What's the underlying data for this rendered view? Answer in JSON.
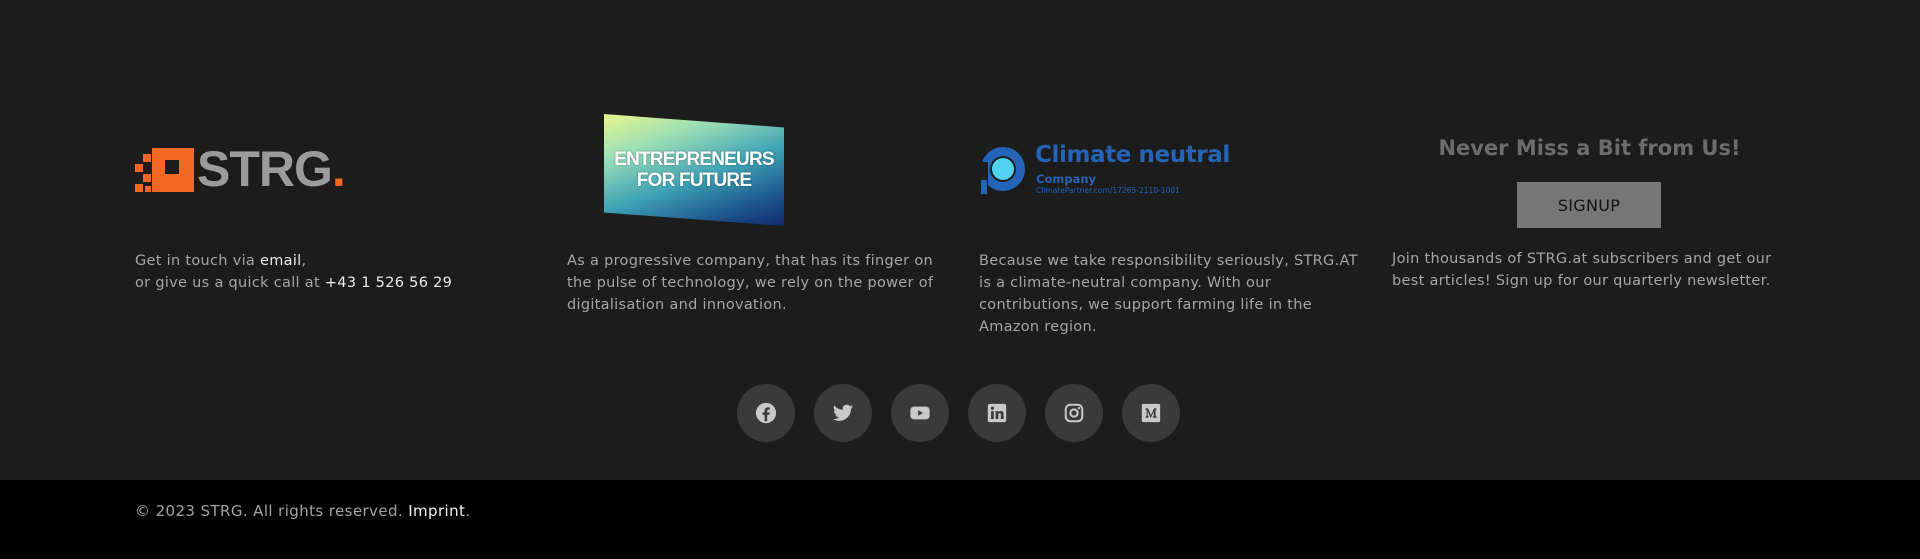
{
  "brand": {
    "logo_text": "STRG",
    "logo_dot": ".",
    "accent": "#f26722"
  },
  "contact": {
    "line1_prefix": "Get in touch via ",
    "email_label": "email",
    "line1_suffix": ",",
    "line2_prefix": "or give us a quick call at ",
    "phone": "+43 1 526 56 29"
  },
  "e4f": {
    "line1": "ENTREPRENEURS",
    "line2": "FOR FUTURE",
    "text": "As a progressive company, that has its finger on the pulse of technology, we rely on the power of digitalisation and innovation."
  },
  "climate": {
    "title": "Climate neutral",
    "subtitle": "Company",
    "url": "ClimatePartner.com/17265-2110-1001",
    "text": "Because we take responsibility seriously, STRG.AT is a climate-neutral company. With our contributions, we support farming life in the Amazon region.",
    "color": "#2464b7"
  },
  "newsletter": {
    "title": "Never Miss a Bit from Us!",
    "button": "SIGNUP",
    "text": "Join thousands of STRG.at subscribers and get our best articles! Sign up for our quarterly newsletter."
  },
  "social": [
    {
      "name": "facebook-icon"
    },
    {
      "name": "twitter-icon"
    },
    {
      "name": "youtube-icon"
    },
    {
      "name": "linkedin-icon"
    },
    {
      "name": "instagram-icon"
    },
    {
      "name": "medium-icon"
    }
  ],
  "bottom": {
    "copyright": "© 2023 STRG. All rights reserved. ",
    "imprint": "Imprint",
    "suffix": "."
  }
}
